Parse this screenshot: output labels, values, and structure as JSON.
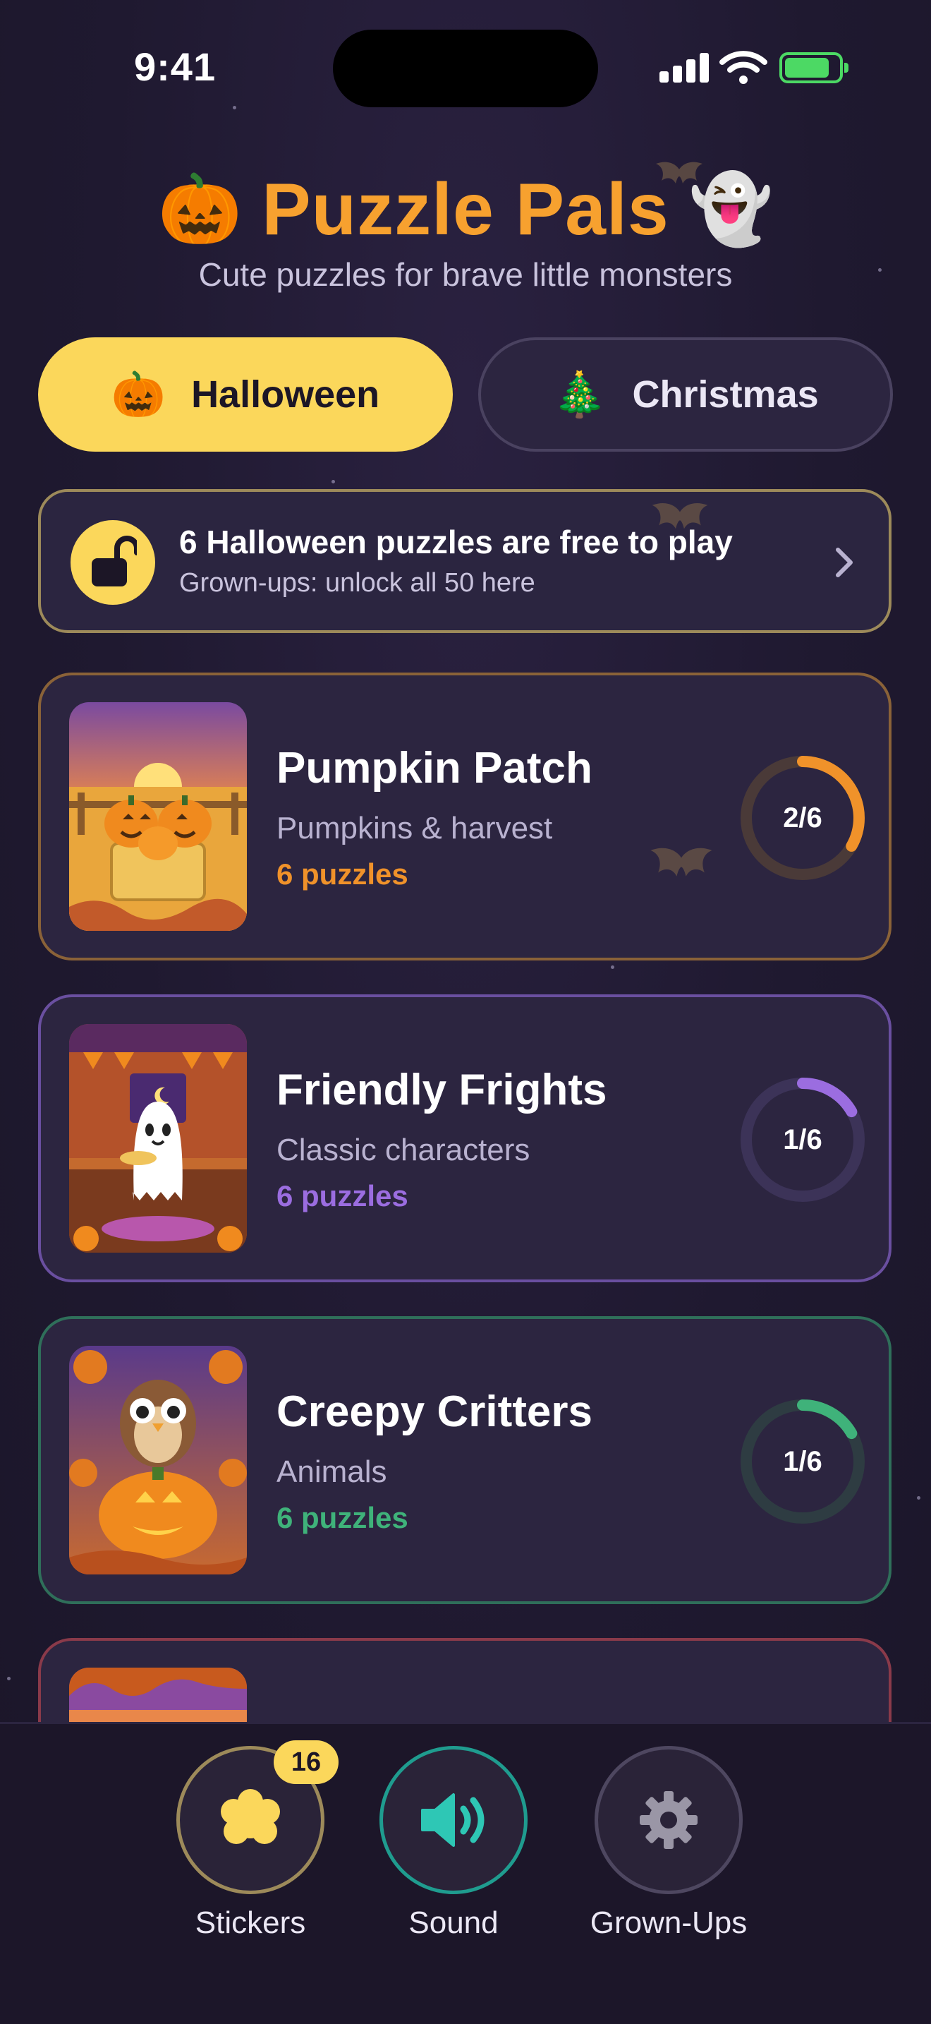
{
  "status_bar": {
    "time": "9:41"
  },
  "header": {
    "title": "Puzzle Pals",
    "title_left_emoji": "🎃",
    "title_right_emoji": "👻",
    "subtitle": "Cute puzzles for brave little monsters"
  },
  "tabs": [
    {
      "emoji": "🎃",
      "label": "Halloween",
      "selected": true
    },
    {
      "emoji": "🎄",
      "label": "Christmas",
      "selected": false
    }
  ],
  "unlock_banner": {
    "title": "6 Halloween puzzles are free to play",
    "subtitle": "Grown-ups: unlock all 50 here",
    "icon": "unlock-icon"
  },
  "packs": [
    {
      "title": "Pumpkin Patch",
      "subtitle": "Pumpkins & harvest",
      "count_label": "6 puzzles",
      "progress_label": "2/6",
      "progress": 0.333,
      "accent": "#f0922a",
      "border": "#8a6238",
      "track": "#4a3a38"
    },
    {
      "title": "Friendly Frights",
      "subtitle": "Classic characters",
      "count_label": "6 puzzles",
      "progress_label": "1/6",
      "progress": 0.1667,
      "accent": "#9b6de0",
      "border": "#6a4fa0",
      "track": "#3c3358"
    },
    {
      "title": "Creepy Critters",
      "subtitle": "Animals",
      "count_label": "6 puzzles",
      "progress_label": "1/6",
      "progress": 0.1667,
      "accent": "#3fb27a",
      "border": "#2f6f5a",
      "track": "#2e3c42"
    }
  ],
  "bottom_nav": {
    "stickers": {
      "label": "Stickers",
      "badge": "16",
      "icon": "sticker-flower-icon",
      "color": "#fbd75b",
      "border": "#9d8a5a"
    },
    "sound": {
      "label": "Sound",
      "icon": "speaker-icon",
      "color": "#2ec7b5",
      "border": "#1f9c8f"
    },
    "grownups": {
      "label": "Grown-Ups",
      "icon": "gear-icon",
      "color": "#9a96a6",
      "border": "#4e4760"
    }
  },
  "colors": {
    "background": "#1f1930",
    "title": "#f7a12f",
    "accent_yellow": "#fbd75b"
  }
}
